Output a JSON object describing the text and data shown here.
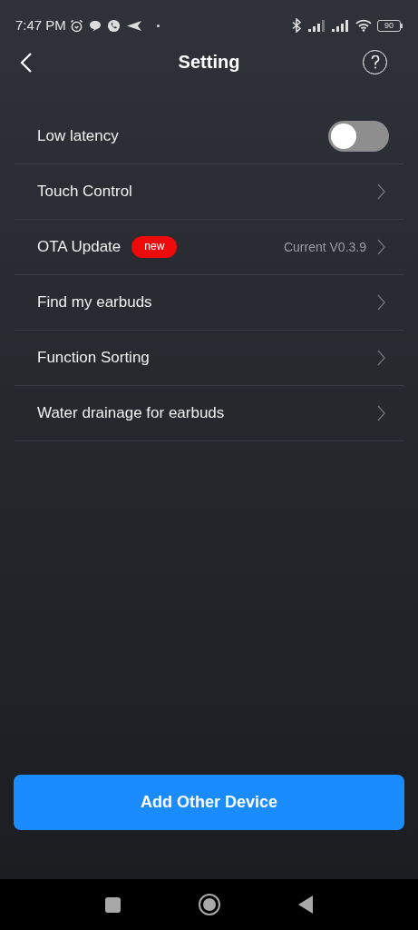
{
  "status_bar": {
    "time": "7:47 PM",
    "battery": "90"
  },
  "header": {
    "title": "Setting"
  },
  "settings": [
    {
      "kind": "toggle",
      "label": "Low latency",
      "on": false
    },
    {
      "kind": "link",
      "label": "Touch Control"
    },
    {
      "kind": "link",
      "label": "OTA Update",
      "badge": "new",
      "value": "Current V0.3.9"
    },
    {
      "kind": "link",
      "label": "Find my earbuds"
    },
    {
      "kind": "link",
      "label": "Function Sorting"
    },
    {
      "kind": "link",
      "label": "Water drainage for earbuds"
    }
  ],
  "primary_button": "Add Other Device"
}
